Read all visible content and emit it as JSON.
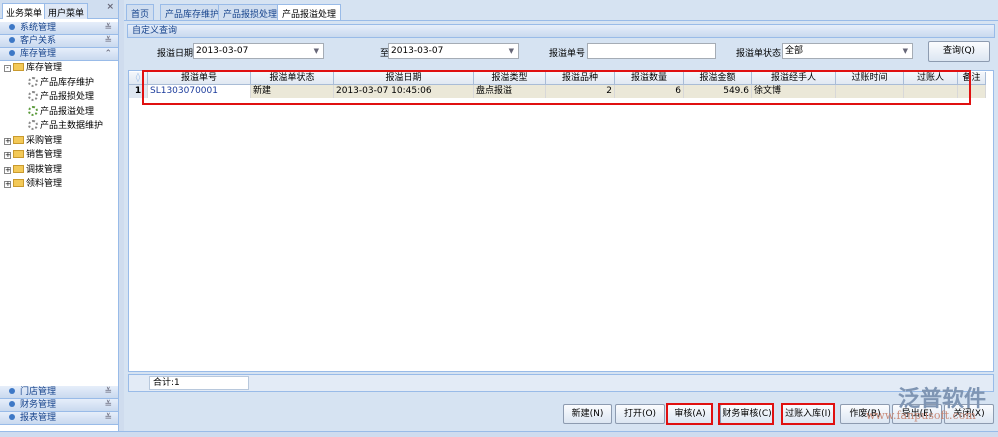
{
  "sidebar": {
    "tabs": [
      "业务菜单",
      "用户菜单"
    ],
    "close": "×",
    "top_groups": [
      {
        "label": "系统管理",
        "chev": "≚"
      },
      {
        "label": "客户关系",
        "chev": "≚"
      },
      {
        "label": "库存管理",
        "chev": "⌃"
      }
    ],
    "tree": {
      "root": "库存管理",
      "children": [
        "产品库存维护",
        "产品报损处理",
        "产品报溢处理",
        "产品主数据维护"
      ],
      "others": [
        "采购管理",
        "销售管理",
        "调拨管理",
        "领料管理"
      ]
    },
    "bottom_groups": [
      {
        "label": "门店管理",
        "chev": "≚"
      },
      {
        "label": "财务管理",
        "chev": "≚"
      },
      {
        "label": "报表管理",
        "chev": "≚"
      }
    ]
  },
  "tabs": [
    "首页",
    "产品库存维护",
    "产品报损处理",
    "产品报溢处理"
  ],
  "query": {
    "title": "自定义查询",
    "date_label": "报溢日期",
    "date_from": "2013-03-07",
    "to_label": "至",
    "date_to": "2013-03-07",
    "no_label": "报溢单号",
    "no_value": "",
    "status_label": "报溢单状态",
    "status_value": "全部",
    "search": "查询(Q)"
  },
  "grid": {
    "headers": [
      "报溢单号",
      "报溢单状态",
      "报溢日期",
      "报溢类型",
      "报溢品种",
      "报溢数量",
      "报溢金额",
      "报溢经手人",
      "过账时间",
      "过账人",
      "备注"
    ],
    "rows": [
      {
        "n": "1",
        "cells": [
          "SL1303070001",
          "新建",
          "2013-03-07 10:45:06",
          "盘点报溢",
          "2",
          "6",
          "549.6",
          "徐文博",
          "",
          "",
          ""
        ]
      }
    ],
    "total": "合计:1"
  },
  "buttons": [
    "新建(N)",
    "打开(O)",
    "审核(A)",
    "财务审核(C)",
    "过账入库(I)",
    "作废(B)",
    "导出(E)",
    "关闭(X)"
  ],
  "watermark": {
    "name": "泛普软件",
    "url": "www.fanpusoft.com"
  }
}
